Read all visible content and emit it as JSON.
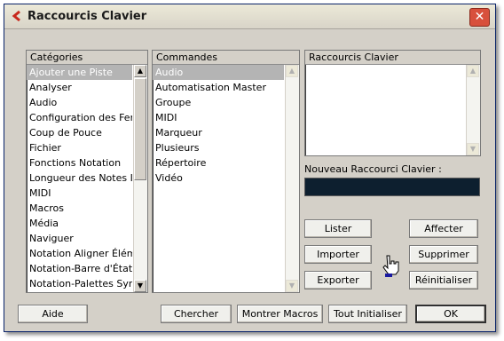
{
  "window": {
    "title": "Raccourcis Clavier",
    "close_label": "✕"
  },
  "categories": {
    "header": "Catégories",
    "items": [
      "Ajouter une Piste",
      "Analyser",
      "Audio",
      "Configuration des Fenêt",
      "Coup de Pouce",
      "Fichier",
      "Fonctions Notation",
      "Longueur des Notes Ins",
      "MIDI",
      "Macros",
      "Média",
      "Naviguer",
      "Notation Aligner Élémen",
      "Notation-Barre d'État",
      "Notation-Palettes Symbo"
    ],
    "selected_index": 0
  },
  "commands": {
    "header": "Commandes",
    "items": [
      "Audio",
      "Automatisation Master",
      "Groupe",
      "MIDI",
      "Marqueur",
      "Plusieurs",
      "Répertoire",
      "Vidéo"
    ],
    "selected_index": 0
  },
  "shortcuts": {
    "header": "Raccourcis Clavier"
  },
  "new_shortcut": {
    "label": "Nouveau Raccourci Clavier :",
    "value": ""
  },
  "buttons": {
    "lister": "Lister",
    "affecter": "Affecter",
    "importer": "Importer",
    "supprimer": "Supprimer",
    "exporter": "Exporter",
    "reinitialiser": "Réinitialiser",
    "aide": "Aide",
    "chercher": "Chercher",
    "montrer_macros": "Montrer Macros",
    "tout_initialiser": "Tout Initialiser",
    "ok": "OK"
  },
  "colors": {
    "selection": "#b4b4b4",
    "new_shortcut_field": "#0d1f2f",
    "close": "#d8503c"
  }
}
